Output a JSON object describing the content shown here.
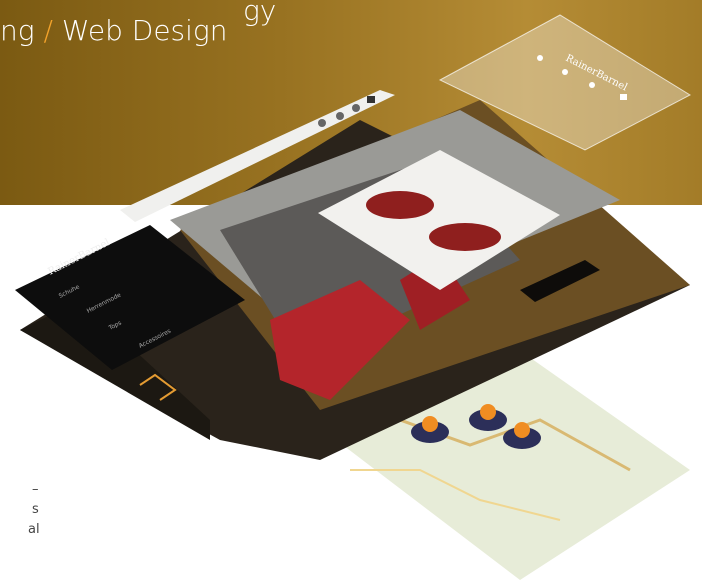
{
  "header": {
    "title_line1": "gy",
    "title_line2_a": "ng",
    "title_line2_sep": "/",
    "title_line2_b": "Web Design"
  },
  "mockup": {
    "brand": "RainerBarnel",
    "menu": [
      "Schuhe",
      "Herrenmode",
      "Tops",
      "Accessoires"
    ],
    "toolbar_icons": [
      "user-icon",
      "search-icon",
      "heart-icon",
      "cart-icon"
    ]
  },
  "sidebar_text": [
    "–",
    "s",
    "al"
  ],
  "colors": {
    "accent": "#f3a32b",
    "hero": "#987221"
  }
}
